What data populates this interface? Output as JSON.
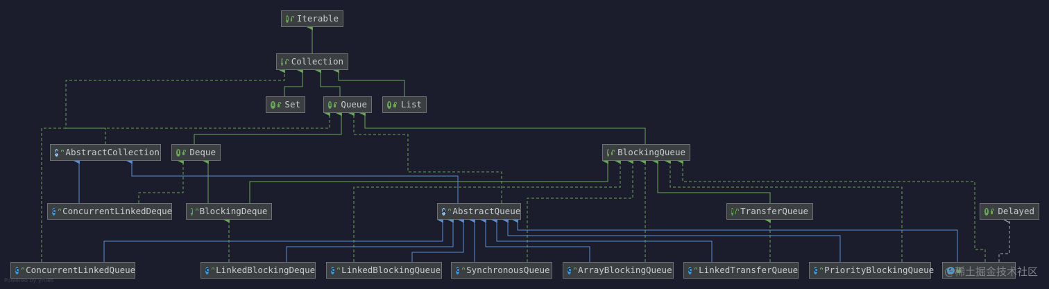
{
  "diagram": {
    "nodes": [
      {
        "id": "iterable",
        "label": "Iterable",
        "kind": "interface"
      },
      {
        "id": "collection",
        "label": "Collection",
        "kind": "interface"
      },
      {
        "id": "set",
        "label": "Set",
        "kind": "interface"
      },
      {
        "id": "queue",
        "label": "Queue",
        "kind": "interface"
      },
      {
        "id": "list",
        "label": "List",
        "kind": "interface"
      },
      {
        "id": "abstract-collection",
        "label": "AbstractCollection",
        "kind": "abstract-class"
      },
      {
        "id": "deque",
        "label": "Deque",
        "kind": "interface"
      },
      {
        "id": "blocking-queue",
        "label": "BlockingQueue",
        "kind": "interface"
      },
      {
        "id": "concurrent-linked-deque",
        "label": "ConcurrentLinkedDeque",
        "kind": "class"
      },
      {
        "id": "blocking-deque",
        "label": "BlockingDeque",
        "kind": "interface"
      },
      {
        "id": "abstract-queue",
        "label": "AbstractQueue",
        "kind": "abstract-class"
      },
      {
        "id": "transfer-queue",
        "label": "TransferQueue",
        "kind": "interface"
      },
      {
        "id": "delayed",
        "label": "Delayed",
        "kind": "interface"
      },
      {
        "id": "concurrent-linked-queue",
        "label": "ConcurrentLinkedQueue",
        "kind": "class"
      },
      {
        "id": "linked-blocking-deque",
        "label": "LinkedBlockingDeque",
        "kind": "class"
      },
      {
        "id": "linked-blocking-queue",
        "label": "LinkedBlockingQueue",
        "kind": "class"
      },
      {
        "id": "synchronous-queue",
        "label": "SynchronousQueue",
        "kind": "class"
      },
      {
        "id": "array-blocking-queue",
        "label": "ArrayBlockingQueue",
        "kind": "class"
      },
      {
        "id": "linked-transfer-queue",
        "label": "LinkedTransferQueue",
        "kind": "class"
      },
      {
        "id": "priority-blocking-queue",
        "label": "PriorityBlockingQueue",
        "kind": "class"
      },
      {
        "id": "delay-queue",
        "label": "",
        "kind": "class"
      }
    ]
  },
  "colors": {
    "background": "#1b1d2d",
    "node_fill": "#3c3f41",
    "node_border": "#6e7073",
    "extends_edge": "#6aa755",
    "class_extends_edge": "#5b8ed4",
    "implements_edge": "#6aa755"
  },
  "footer": {
    "powered_by": "Powered by yFiles",
    "watermark": "@稀土掘金技术社区"
  }
}
